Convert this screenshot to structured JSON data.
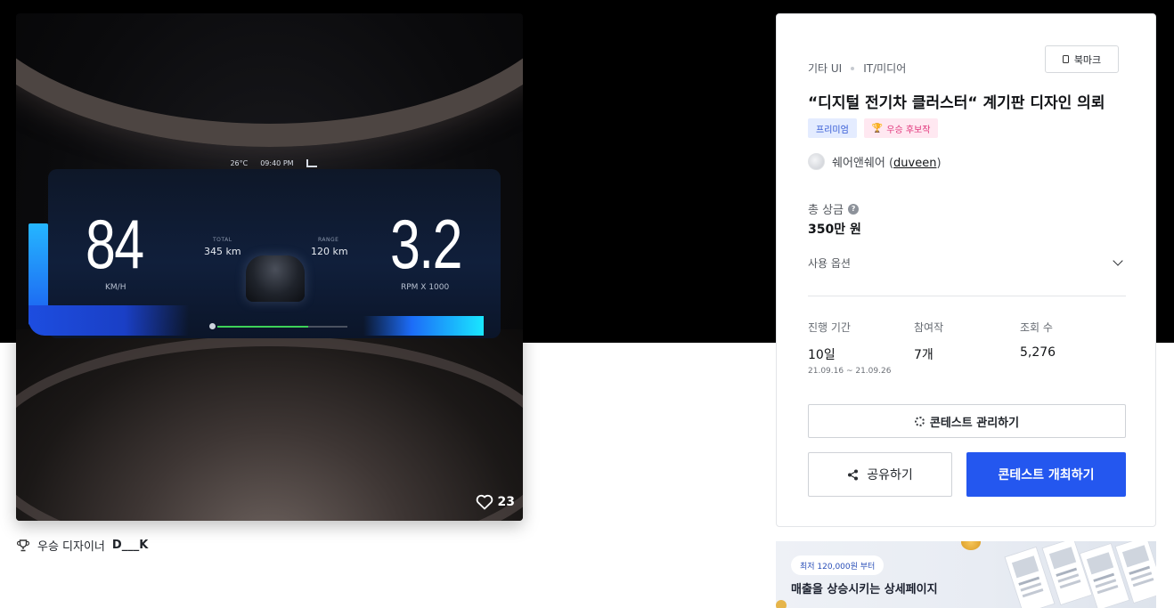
{
  "artwork": {
    "dashboard": {
      "temperature": "26°C",
      "clock": "09:40 PM",
      "speed": "84",
      "speed_unit": "KM/H",
      "total_label": "TOTAL",
      "total_value": "345 km",
      "range_label": "RANGE",
      "range_value": "120 km",
      "rpm": "3.2",
      "rpm_unit": "RPM X 1000",
      "battery_progress": 0.7
    },
    "likes_count": "23",
    "icons": {
      "likes": "heart-icon",
      "signal": "signal-icon"
    }
  },
  "winner": {
    "label": "우승 디자이너",
    "name": "D___K",
    "icon": "trophy-icon"
  },
  "card": {
    "breadcrumb": [
      "기타 UI",
      "IT/미디어"
    ],
    "bookmark_label": "북마크",
    "title": "“디지털 전기차 클러스터“ 계기판 디자인 의뢰",
    "badges": {
      "premium": "프리미엄",
      "winner_candidate": "우승 후보작"
    },
    "host": {
      "name": "쉐어앤쉐어",
      "handle": "duveen",
      "paren_open": "(",
      "paren_close": ")"
    },
    "prize": {
      "label": "총 상금",
      "help": "?",
      "amount": "350만 원"
    },
    "usage_option_label": "사용 옵션",
    "stats": {
      "period": {
        "label": "진행 기간",
        "value": "10일",
        "sub": "21.09.16  ~  21.09.26"
      },
      "entries": {
        "label": "참여작",
        "value": "7개"
      },
      "views": {
        "label": "조회 수",
        "value": "5,276"
      }
    },
    "manage_button": "콘테스트 관리하기",
    "share_button": "공유하기",
    "host_button": "콘테스트 개최하기"
  },
  "ad": {
    "pill": "최저 120,000원 부터",
    "text": "매출을 상승시키는 상세페이지"
  },
  "colors": {
    "primary": "#2457ef",
    "premium_badge_bg": "#e4ecff",
    "winner_badge_bg": "#ffe8f1",
    "progress": "#3dd158"
  }
}
